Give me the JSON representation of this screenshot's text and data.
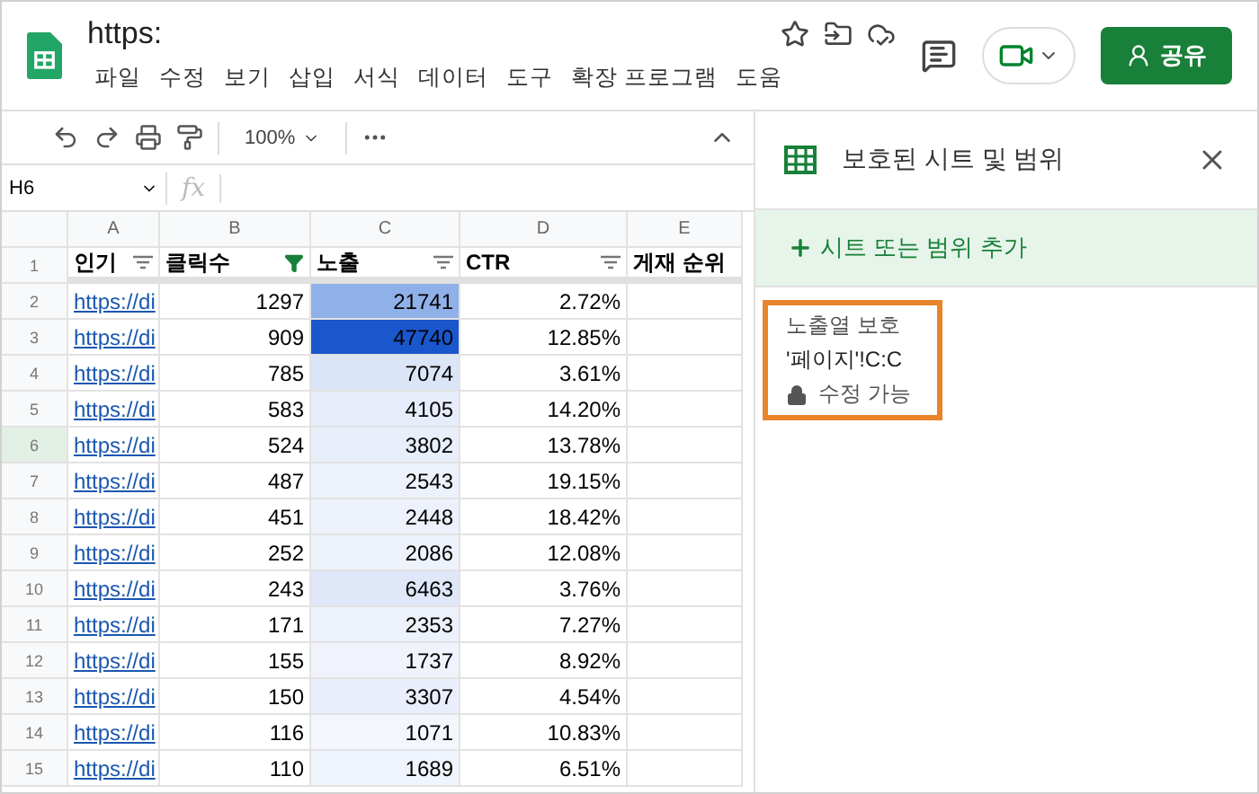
{
  "doc": {
    "title": "https:"
  },
  "menu": [
    {
      "label": "파일"
    },
    {
      "label": "수정"
    },
    {
      "label": "보기"
    },
    {
      "label": "삽입"
    },
    {
      "label": "서식"
    },
    {
      "label": "데이터"
    },
    {
      "label": "도구"
    },
    {
      "label": "확장 프로그램"
    },
    {
      "label": "도움"
    }
  ],
  "share_button": {
    "label": "공유"
  },
  "toolbar": {
    "zoom": "100%"
  },
  "formula_bar": {
    "cell": "H6",
    "fx": "fx"
  },
  "columns": [
    {
      "letter": "A",
      "label": "인기",
      "has_filter": true,
      "filter_active": false
    },
    {
      "letter": "B",
      "label": "클릭수",
      "has_filter": true,
      "filter_active": true
    },
    {
      "letter": "C",
      "label": "노출",
      "has_filter": true,
      "filter_active": false
    },
    {
      "letter": "D",
      "label": "CTR",
      "has_filter": true,
      "filter_active": false
    },
    {
      "letter": "E",
      "label": "게재 순위",
      "has_filter": false
    }
  ],
  "header_row": "1",
  "rows": [
    {
      "num": "2",
      "link": "https://di",
      "clicks": "1297",
      "impressions": "21741",
      "ctr": "2.72%",
      "color": "#8fb0e8",
      "selected": false
    },
    {
      "num": "3",
      "link": "https://di",
      "clicks": "909",
      "impressions": "47740",
      "ctr": "12.85%",
      "color": "#1a56cc",
      "selected": false
    },
    {
      "num": "4",
      "link": "https://di",
      "clicks": "785",
      "impressions": "7074",
      "ctr": "3.61%",
      "color": "#dbe5f8",
      "selected": false
    },
    {
      "num": "5",
      "link": "https://di",
      "clicks": "583",
      "impressions": "4105",
      "ctr": "14.20%",
      "color": "#e6ecf9",
      "selected": false
    },
    {
      "num": "6",
      "link": "https://di",
      "clicks": "524",
      "impressions": "3802",
      "ctr": "13.78%",
      "color": "#e8eefa",
      "selected": true
    },
    {
      "num": "7",
      "link": "https://di",
      "clicks": "487",
      "impressions": "2543",
      "ctr": "19.15%",
      "color": "#ecf1fb",
      "selected": false
    },
    {
      "num": "8",
      "link": "https://di",
      "clicks": "451",
      "impressions": "2448",
      "ctr": "18.42%",
      "color": "#edf1fb",
      "selected": false
    },
    {
      "num": "9",
      "link": "https://di",
      "clicks": "252",
      "impressions": "2086",
      "ctr": "12.08%",
      "color": "#eef2fb",
      "selected": false
    },
    {
      "num": "10",
      "link": "https://di",
      "clicks": "243",
      "impressions": "6463",
      "ctr": "3.76%",
      "color": "#dfe7f8",
      "selected": false
    },
    {
      "num": "11",
      "link": "https://di",
      "clicks": "171",
      "impressions": "2353",
      "ctr": "7.27%",
      "color": "#edf1fb",
      "selected": false
    },
    {
      "num": "12",
      "link": "https://di",
      "clicks": "155",
      "impressions": "1737",
      "ctr": "8.92%",
      "color": "#f0f3fc",
      "selected": false
    },
    {
      "num": "13",
      "link": "https://di",
      "clicks": "150",
      "impressions": "3307",
      "ctr": "4.54%",
      "color": "#e9eefa",
      "selected": false
    },
    {
      "num": "14",
      "link": "https://di",
      "clicks": "116",
      "impressions": "1071",
      "ctr": "10.83%",
      "color": "#f3f6fc",
      "selected": false
    },
    {
      "num": "15",
      "link": "https://di",
      "clicks": "110",
      "impressions": "1689",
      "ctr": "6.51%",
      "color": "#f0f4fc",
      "selected": false
    }
  ],
  "panel": {
    "title": "보호된 시트 및 범위",
    "add_label": "시트 또는 범위 추가",
    "ranges": [
      {
        "name": "노출열 보호",
        "range": "'페이지'!C:C",
        "permission": "수정 가능",
        "highlighted": true
      }
    ]
  }
}
